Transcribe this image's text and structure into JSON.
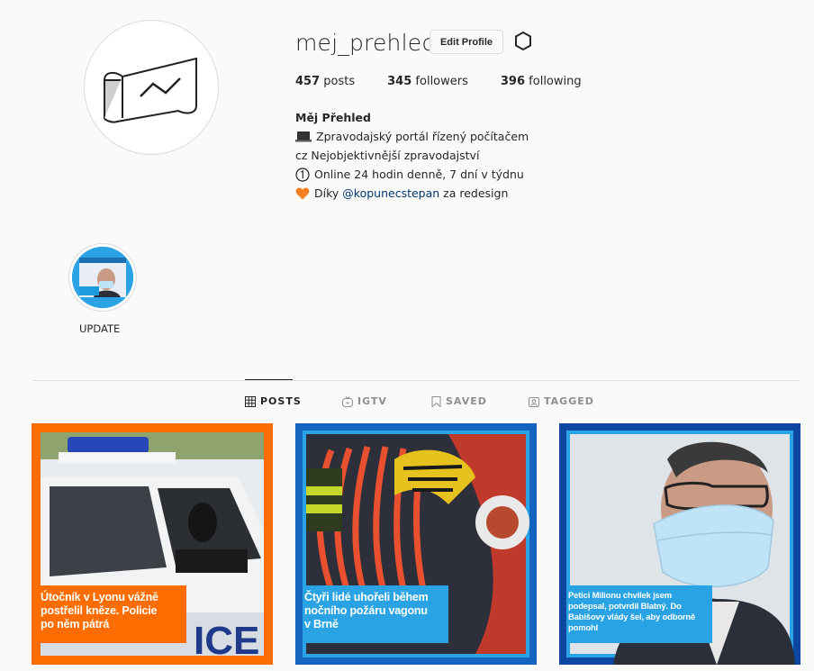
{
  "profile": {
    "username": "mej_prehled",
    "edit_label": "Edit Profile",
    "stats": {
      "posts_count": "457",
      "posts_label": "posts",
      "followers_count": "345",
      "followers_label": "followers",
      "following_count": "396",
      "following_label": "following"
    },
    "bio": {
      "name": "Měj Přehled",
      "line1": "Zpravodajský portál řízený počítačem",
      "line2": "cz Nejobjektivnější zpravodajství",
      "line3": "Online 24 hodin denně, 7 dní v týdnu",
      "line4_prefix": "Díky",
      "line4_link": "@kopunecstepan",
      "line4_suffix": "za redesign"
    }
  },
  "highlights": [
    {
      "label": "UPDATE"
    }
  ],
  "tabs": [
    {
      "label": "POSTS",
      "icon": "grid-icon",
      "active": true
    },
    {
      "label": "IGTV",
      "icon": "igtv-icon",
      "active": false
    },
    {
      "label": "SAVED",
      "icon": "bookmark-icon",
      "active": false
    },
    {
      "label": "TAGGED",
      "icon": "tagged-icon",
      "active": false
    }
  ],
  "posts": [
    {
      "caption": [
        "Útočník v Lyonu vážně",
        "postřelil kněze. Policie",
        "po něm pátrá"
      ],
      "frame_color": "#ff6d00"
    },
    {
      "caption": [
        "Čtyři lidé uhořeli během",
        "nočního požáru vagonu",
        "v Brně"
      ],
      "frame_color": "#1565c0"
    },
    {
      "caption": [
        "Petici Milionu chvilek jsem",
        "podepsal, potvrdil Blatný. Do",
        "Babišovy vlády šel, aby odborně",
        "pomohl"
      ],
      "frame_color": "#0d47a1"
    }
  ],
  "colors": {
    "link": "#00376b",
    "accent_blue": "#1e9be0",
    "orange": "#ff6d00"
  }
}
